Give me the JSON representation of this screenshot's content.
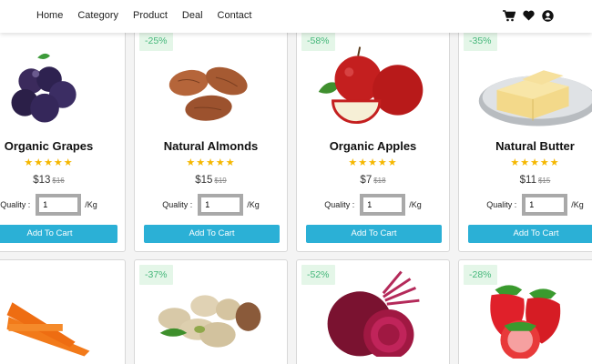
{
  "nav": {
    "links": [
      "Home",
      "Category",
      "Product",
      "Deal",
      "Contact"
    ],
    "icons": [
      "cart-icon",
      "heart-icon",
      "account-icon"
    ]
  },
  "labels": {
    "quality": "Quality :",
    "unit": "/Kg",
    "add_to_cart": "Add To Cart"
  },
  "products": [
    {
      "name": "Organic Grapes",
      "discount": "%",
      "price": "$13",
      "old_price": "$16",
      "qty": "1",
      "rating": 4.5,
      "stars": "★★★★★"
    },
    {
      "name": "Natural Almonds",
      "discount": "-25%",
      "price": "$15",
      "old_price": "$19",
      "qty": "1",
      "rating": 4.5,
      "stars": "★★★★★"
    },
    {
      "name": "Organic Apples",
      "discount": "-58%",
      "price": "$7",
      "old_price": "$18",
      "qty": "1",
      "rating": 4.5,
      "stars": "★★★★★"
    },
    {
      "name": "Natural Butter",
      "discount": "-35%",
      "price": "$11",
      "old_price": "$15",
      "qty": "1",
      "rating": 4.5,
      "stars": "★★★★★"
    }
  ],
  "products_row2": [
    {
      "discount": "%",
      "image": "carrots"
    },
    {
      "discount": "-37%",
      "image": "pistachios"
    },
    {
      "discount": "-52%",
      "image": "beetroot"
    },
    {
      "discount": "-28%",
      "image": "strawberries"
    }
  ],
  "colors": {
    "accent": "#2bb0d6",
    "badge_bg": "#e4f6e8",
    "badge_text": "#45b77a",
    "star": "#f5b700"
  }
}
